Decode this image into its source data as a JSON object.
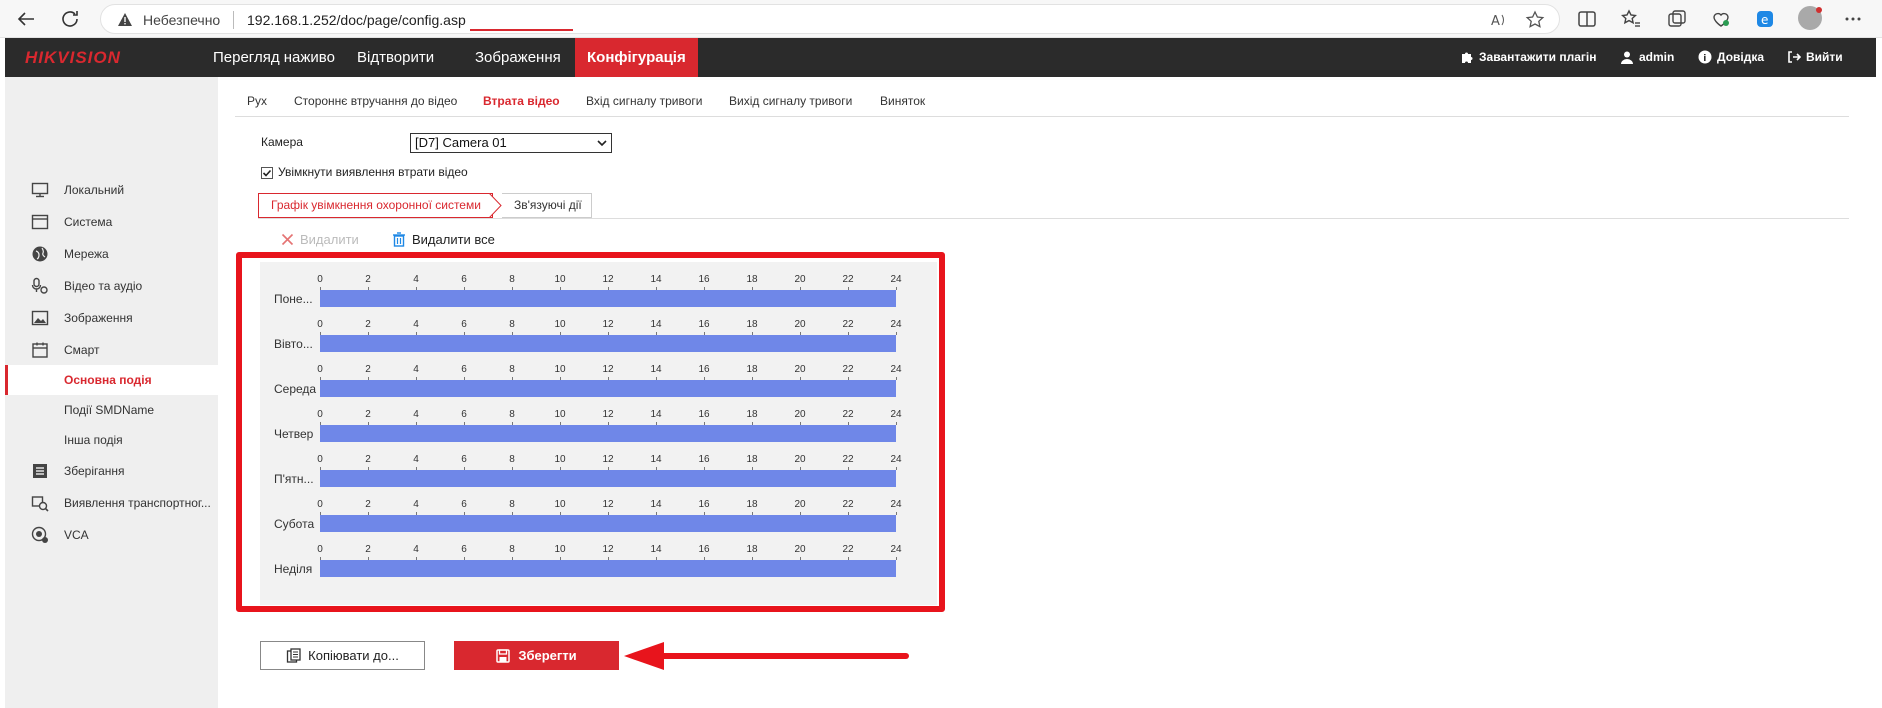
{
  "browser": {
    "security_text": "Небезпечно",
    "url": "192.168.1.252/doc/page/config.asp"
  },
  "header": {
    "logo": "HIKVISION",
    "nav": [
      "Перегляд наживо",
      "Відтворити",
      "Зображення",
      "Конфігурація"
    ],
    "active_nav": "Конфігурація",
    "download_plugin": "Завантажити плагін",
    "user": "admin",
    "help": "Довідка",
    "logout": "Вийти",
    "accent_color": "#d9282f"
  },
  "sidebar": {
    "items": [
      {
        "label": "Локальний",
        "icon": "monitor-icon"
      },
      {
        "label": "Система",
        "icon": "window-icon"
      },
      {
        "label": "Мережа",
        "icon": "globe-icon"
      },
      {
        "label": "Відео та аудіо",
        "icon": "mic-camera-icon"
      },
      {
        "label": "Зображення",
        "icon": "image-icon"
      },
      {
        "label": "Смарт",
        "icon": "calendar-icon"
      },
      {
        "label": "Основна подія",
        "icon": ""
      },
      {
        "label": "Події SMDName",
        "icon": ""
      },
      {
        "label": "Інша подія",
        "icon": ""
      },
      {
        "label": "Зберігання",
        "icon": "storage-icon"
      },
      {
        "label": "Виявлення транспортног...",
        "icon": "vehicle-search-icon"
      },
      {
        "label": "VCA",
        "icon": "vca-icon"
      }
    ],
    "active": "Основна подія"
  },
  "tabs": [
    "Рух",
    "Стороннє втручання до відео",
    "Втрата відео",
    "Вхід сигналу тривоги",
    "Вихід сигналу тривоги",
    "Виняток"
  ],
  "active_tab": "Втрата відео",
  "form": {
    "camera_label": "Камера",
    "camera_value": "[D7] Camera 01",
    "enable_checkbox_label": "Увімкнути виявлення втрати відео",
    "enable_checked": true
  },
  "subtabs": [
    "Графік увімкнення охоронної системи",
    "Зв'язуючі дії"
  ],
  "actions": {
    "delete": "Видалити",
    "delete_all": "Видалити все"
  },
  "schedule": {
    "ticks": [
      "0",
      "2",
      "4",
      "6",
      "8",
      "10",
      "12",
      "14",
      "16",
      "18",
      "20",
      "22",
      "24"
    ],
    "days": [
      "Поне...",
      "Вівто...",
      "Середа",
      "Четвер",
      "П'ятн...",
      "Субота",
      "Неділя"
    ],
    "coverage": [
      [
        0,
        24
      ],
      [
        0,
        24
      ],
      [
        0,
        24
      ],
      [
        0,
        24
      ],
      [
        0,
        24
      ],
      [
        0,
        24
      ],
      [
        0,
        24
      ]
    ],
    "bar_color": "#6f87e8"
  },
  "buttons": {
    "copy": "Копіювати до...",
    "save": "Зберегти"
  }
}
